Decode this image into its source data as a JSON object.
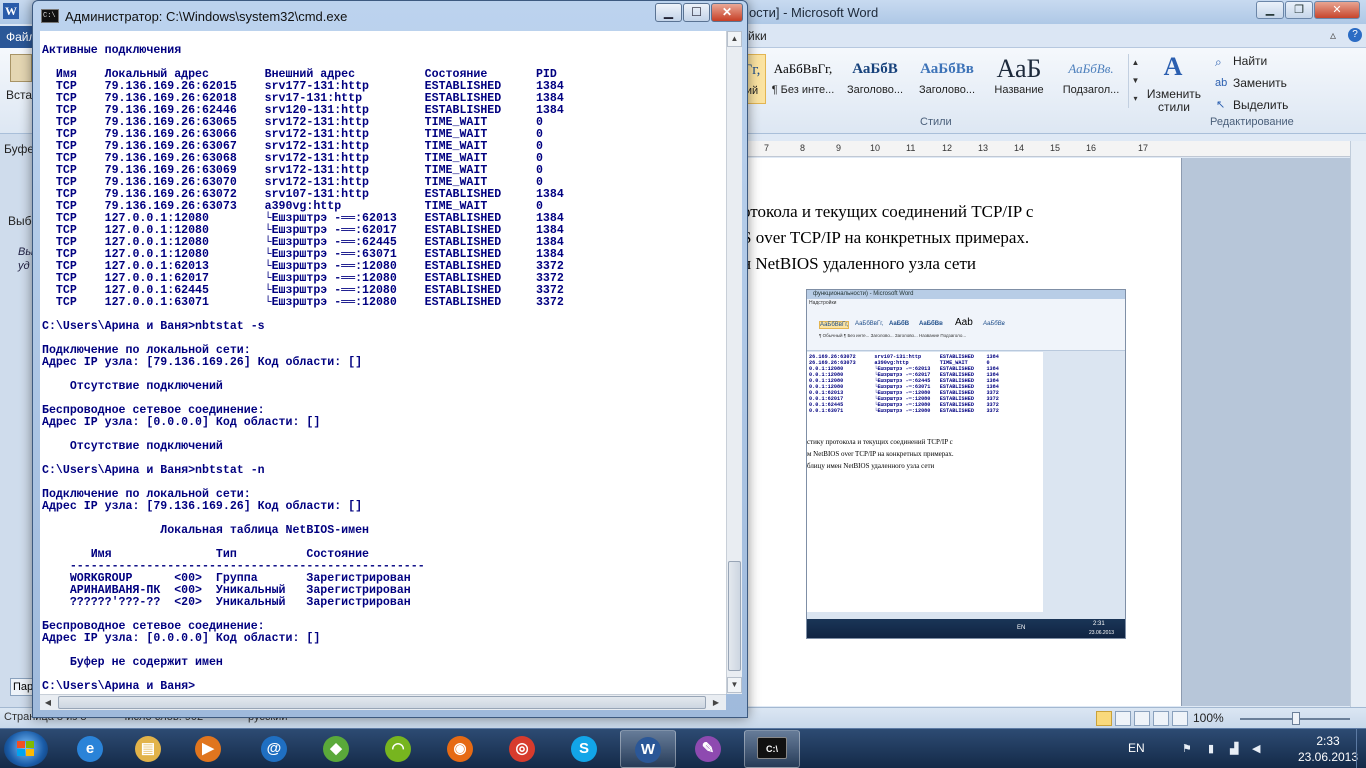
{
  "word": {
    "title": "мости] - Microsoft Word",
    "file_tab": "Файл",
    "refs_tab": "йки",
    "paste_label": "Встав",
    "buffer_label": "Буфе",
    "select_label": "Выбе",
    "styles": [
      {
        "sample": "АаБбВвГг,",
        "name": "¶ Без инте..."
      },
      {
        "sample": "АаБбВ",
        "name": "Заголово..."
      },
      {
        "sample": "АаБбВв",
        "name": "Заголово..."
      },
      {
        "sample": "АаБ",
        "name": "Название"
      },
      {
        "sample": "АаБбВв.",
        "name": "Подзагол..."
      }
    ],
    "style_prefix": "Гг,",
    "style_prefix_name": "ий",
    "change_styles": "Изменить стили",
    "styles_group": "Стили",
    "find": "Найти",
    "replace": "Заменить",
    "select": "Выделить",
    "editing_group": "Редактирование",
    "ruler_marks": [
      "7",
      "8",
      "9",
      "10",
      "11",
      "12",
      "13",
      "14",
      "15",
      "16",
      "17"
    ],
    "doc_lines": [
      "отокола и текущих соединений TCP/IP с",
      "S over TCP/IP на конкретных примерах.",
      "н NetBIOS удаленного узла сети"
    ],
    "zoom": "100%",
    "status_left": "Страница 8 из 8",
    "status_words": "Число слов: 902",
    "status_lang": "русский",
    "left_btn": "Пар",
    "left_text": "Вы",
    "left_text2": "уд"
  },
  "embed": {
    "title": "функциональности) - Microsoft Word",
    "tab": "Надстройки",
    "styles": [
      "АаБбВвГг,",
      "АаБбВвГг,",
      "АаБбВ",
      "АаБбВв",
      "Aab",
      "АаБбВв"
    ],
    "style_names": "¶ Обычный   ¶ Без инте...   Заголово...   Заголово...   Название   Подзаголо...",
    "cmd_text": "26.169.26:63072      srv107-131:http      ESTABLISHED    1384\n26.169.26:63073      a390vg:http          TIME_WAIT      0\n0.0.1:12080          └Ешзрштрэ -═:62013   ESTABLISHED    1384\n0.0.1:12080          └Ешзрштрэ -═:62017   ESTABLISHED    1384\n0.0.1:12080          └Ешзрштрэ -═:62445   ESTABLISHED    1384\n0.0.1:12080          └Ешзрштрэ -═:63071   ESTABLISHED    1384\n0.0.1:62013          └Ешзрштрэ -═:12080   ESTABLISHED    3372\n0.0.1:62017          └Ешзрштрэ -═:12080   ESTABLISHED    3372\n0.0.1:62445          └Ешзрштрэ -═:12080   ESTABLISHED    3372\n0.0.1:63071          └Ешзрштрэ -═:12080   ESTABLISHED    3372",
    "doc_lines": [
      "стику протокола и текущих соединений TCP/IP с",
      "м NetBIOS over TCP/IP на конкретных примерах.",
      "блицу имен NetBIOS удаленного узла сети"
    ],
    "time": "2:31",
    "date": "23.06.2013",
    "lang": "EN"
  },
  "cmd": {
    "title": "Администратор: C:\\Windows\\system32\\cmd.exe",
    "icon_text": "C:\\",
    "content": "Активные подключения\n\n  Имя    Локальный адрес        Внешний адрес          Состояние       PID\n  TCP    79.136.169.26:62015    srv177-131:http        ESTABLISHED     1384\n  TCP    79.136.169.26:62018    srv17-131:http         ESTABLISHED     1384\n  TCP    79.136.169.26:62446    srv120-131:http        ESTABLISHED     1384\n  TCP    79.136.169.26:63065    srv172-131:http        TIME_WAIT       0\n  TCP    79.136.169.26:63066    srv172-131:http        TIME_WAIT       0\n  TCP    79.136.169.26:63067    srv172-131:http        TIME_WAIT       0\n  TCP    79.136.169.26:63068    srv172-131:http        TIME_WAIT       0\n  TCP    79.136.169.26:63069    srv172-131:http        TIME_WAIT       0\n  TCP    79.136.169.26:63070    srv172-131:http        TIME_WAIT       0\n  TCP    79.136.169.26:63072    srv107-131:http        ESTABLISHED     1384\n  TCP    79.136.169.26:63073    a390vg:http            TIME_WAIT       0\n  TCP    127.0.0.1:12080        └Ешзрштрэ -══:62013    ESTABLISHED     1384\n  TCP    127.0.0.1:12080        └Ешзрштрэ -══:62017    ESTABLISHED     1384\n  TCP    127.0.0.1:12080        └Ешзрштрэ -══:62445    ESTABLISHED     1384\n  TCP    127.0.0.1:12080        └Ешзрштрэ -══:63071    ESTABLISHED     1384\n  TCP    127.0.0.1:62013        └Ешзрштрэ -══:12080    ESTABLISHED     3372\n  TCP    127.0.0.1:62017        └Ешзрштрэ -══:12080    ESTABLISHED     3372\n  TCP    127.0.0.1:62445        └Ешзрштрэ -══:12080    ESTABLISHED     3372\n  TCP    127.0.0.1:63071        └Ешзрштрэ -══:12080    ESTABLISHED     3372\n\nC:\\Users\\Арина и Ваня>nbtstat -s\n\nПодключение по локальной сети:\nАдрес IP узла: [79.136.169.26] Код области: []\n\n    Отсутствие подключений\n\nБеспроводное сетевое соединение:\nАдрес IP узла: [0.0.0.0] Код области: []\n\n    Отсутствие подключений\n\nC:\\Users\\Арина и Ваня>nbtstat -n\n\nПодключение по локальной сети:\nАдрес IP узла: [79.136.169.26] Код области: []\n\n                 Локальная таблица NetBIOS-имен\n\n       Имя               Тип          Состояние\n    ---------------------------------------------------\n    WORKGROUP      <00>  Группа       Зарегистрирован\n    АРИНАИВАНЯ-ПК  <00>  Уникальный   Зарегистрирован\n    ??????'???-??  <20>  Уникальный   Зарегистрирован\n\nБеспроводное сетевое соединение:\nАдрес IP узла: [0.0.0.0] Код области: []\n\n    Буфер не содержит имен\n\nC:\\Users\\Арина и Ваня>"
  },
  "taskbar": {
    "apps": [
      {
        "name": "internet-explorer",
        "glyph": "e",
        "color": "#2a83d8"
      },
      {
        "name": "file-explorer",
        "glyph": "▤",
        "color": "#e2b34a"
      },
      {
        "name": "media-player",
        "glyph": "▶",
        "color": "#e0751e"
      },
      {
        "name": "browser-blue",
        "glyph": "@",
        "color": "#1f6fc2"
      },
      {
        "name": "browser-green",
        "glyph": "◆",
        "color": "#5aa93a"
      },
      {
        "name": "wifi-app",
        "glyph": "◠",
        "color": "#77b51f"
      },
      {
        "name": "firefox",
        "glyph": "◉",
        "color": "#e66a14"
      },
      {
        "name": "chrome",
        "glyph": "◎",
        "color": "#d73b2d"
      },
      {
        "name": "skype",
        "glyph": "S",
        "color": "#12a5e8"
      },
      {
        "name": "word",
        "glyph": "W",
        "color": "#2b5797"
      },
      {
        "name": "pencil-app",
        "glyph": "✎",
        "color": "#8e4ab0"
      },
      {
        "name": "cmd",
        "glyph": "C:\\",
        "color": "#111111"
      }
    ],
    "lang": "EN",
    "time": "2:33",
    "date": "23.06.2013"
  }
}
